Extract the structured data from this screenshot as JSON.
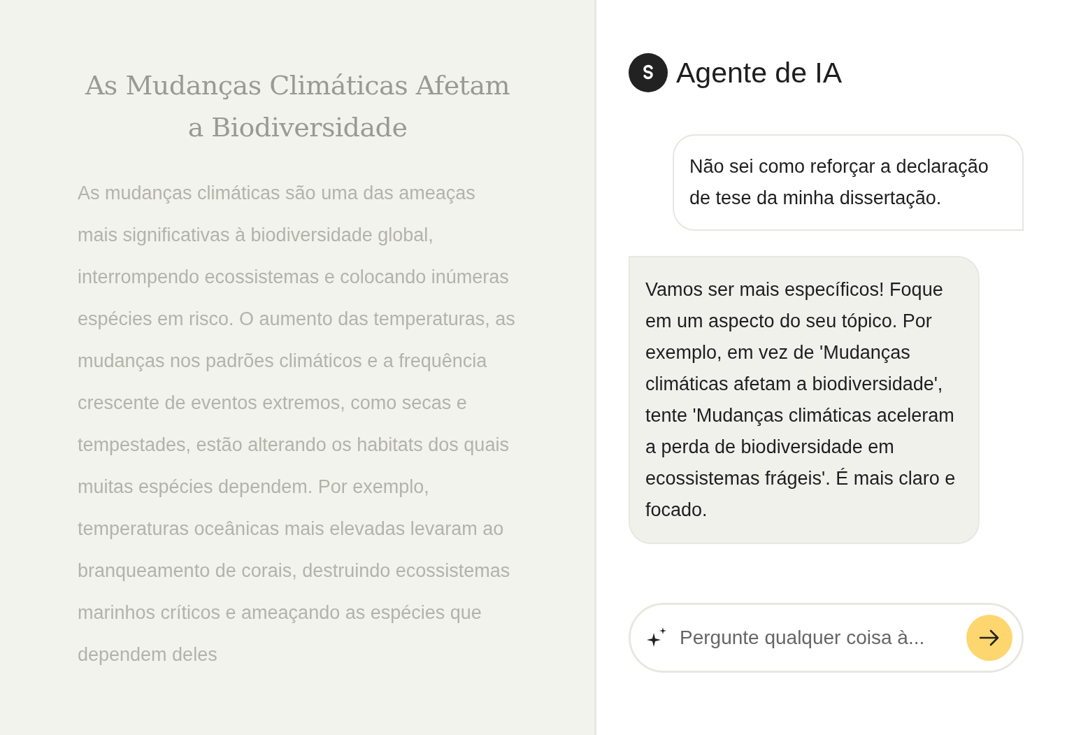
{
  "document": {
    "title": "As Mudanças Climáticas Afetam a Biodiversidade",
    "body": "As mudanças climáticas são uma das ameaças mais significativas à biodiversidade global, interrompendo ecossistemas e colocando inúmeras espécies em risco. O aumento das temperaturas, as mudanças nos padrões climáticos e a frequência crescente de eventos extremos, como secas e tempestades, estão alterando os habitats dos quais muitas espécies dependem. Por exemplo, temperaturas oceânicas mais elevadas levaram ao branqueamento de corais, destruindo ecossistemas marinhos críticos e ameaçando as espécies que dependem deles"
  },
  "assistant": {
    "title": "Agente de IA",
    "messages": [
      {
        "kind": "user",
        "text": "Não sei como reforçar a declaração de tese da minha dissertação."
      },
      {
        "kind": "agent",
        "text": "Vamos ser mais específicos! Foque em um aspecto do seu tópico. Por exemplo, em vez de 'Mudanças climáticas afetam a biodiversidade', tente 'Mudanças climáticas aceleram a perda de biodiversidade em ecossistemas frágeis'. É mais claro e focado."
      }
    ],
    "input": {
      "placeholder": "Pergunte qualquer coisa à..."
    }
  }
}
